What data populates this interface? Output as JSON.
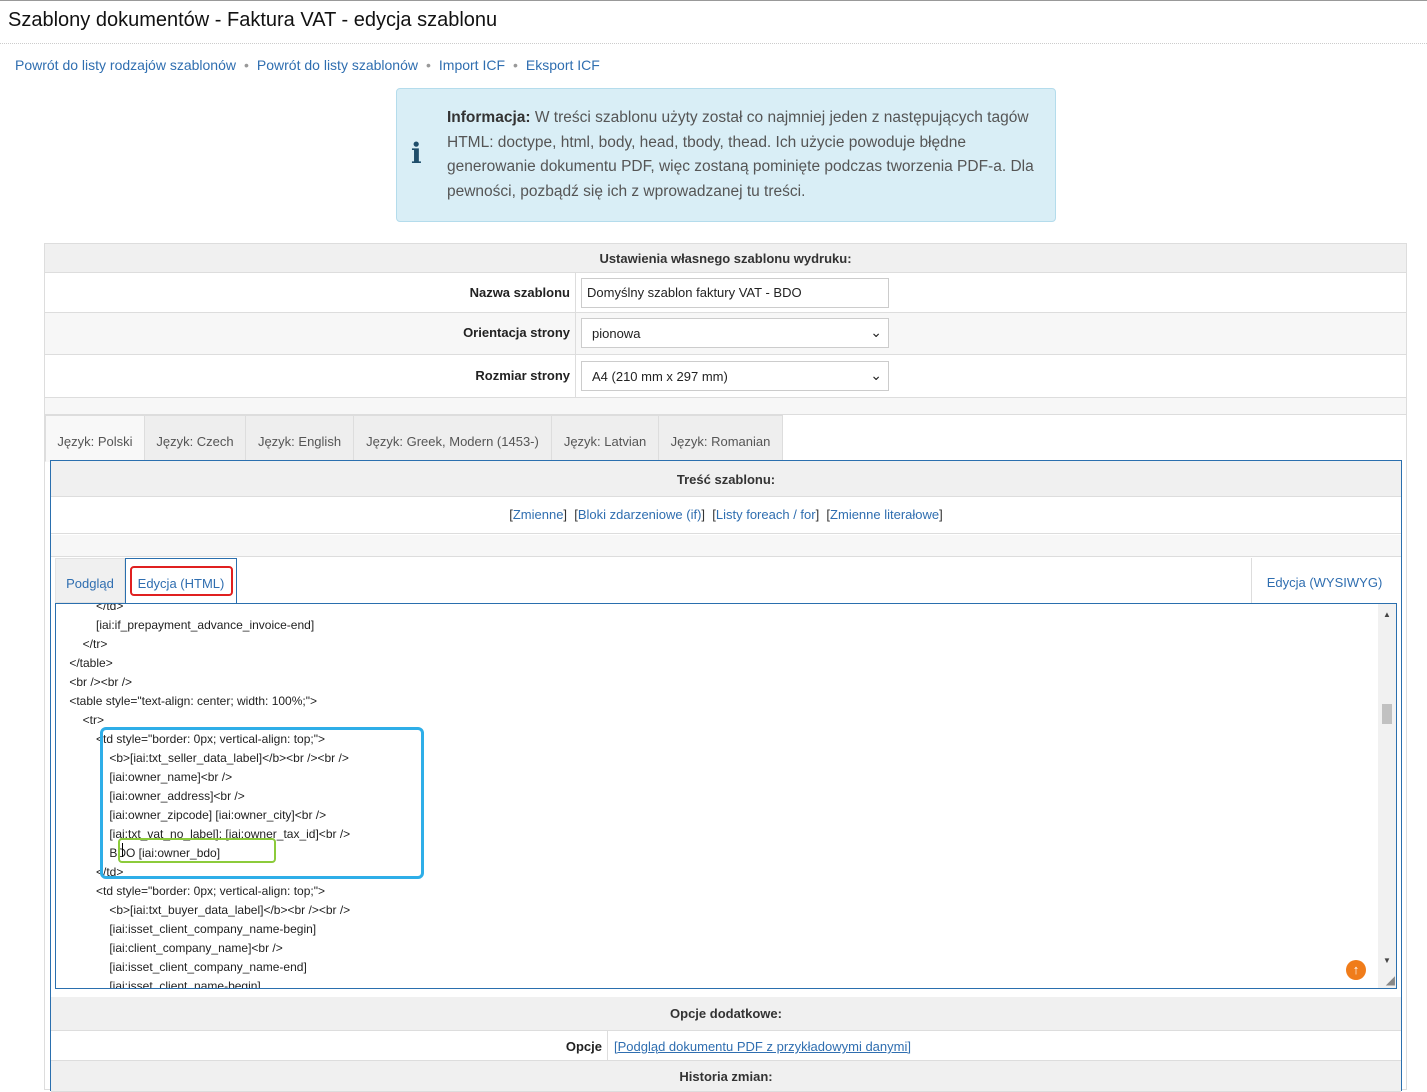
{
  "page": {
    "title": "Szablony dokumentów - Faktura VAT - edycja szablonu"
  },
  "breadcrumb": [
    "Powrót do listy rodzajów szablonów",
    "Powrót do listy szablonów",
    "Import ICF",
    "Eksport ICF"
  ],
  "info": {
    "label": "Informacja:",
    "text": "W treści szablonu użyty został co najmniej jeden z następujących tagów HTML: doctype, html, body, head, tbody, thead. Ich użycie powoduje błędne generowanie dokumentu PDF, więc zostaną pominięte podczas tworzenia PDF-a. Dla pewności, pozbądź się ich z wprowadzanej tu treści.",
    "icon": "info-icon"
  },
  "settings": {
    "header": "Ustawienia własnego szablonu wydruku:",
    "name_label": "Nazwa szablonu",
    "name_value": "Domyślny szablon faktury VAT - BDO",
    "orientation_label": "Orientacja strony",
    "orientation_value": "pionowa",
    "size_label": "Rozmiar strony",
    "size_value": "A4 (210 mm x 297 mm)"
  },
  "language_tabs": [
    "Język: Polski",
    "Język: Czech",
    "Język: English",
    "Język: Greek, Modern (1453-)",
    "Język: Latvian",
    "Język: Romanian"
  ],
  "content": {
    "header": "Treść szablonu:",
    "links": [
      "Zmienne",
      "Bloki zdarzeniowe (if)",
      "Listy foreach / for",
      "Zmienne literałowe"
    ]
  },
  "editor_tabs": {
    "preview": "Podgląd",
    "html": "Edycja (HTML)",
    "wysiwyg": "Edycja (WYSIWYG)"
  },
  "code_lines": [
    "            </td>",
    "            [iai:if_prepayment_advance_invoice-end]",
    "        </tr>",
    "    </table>",
    "    <br /><br />",
    "    <table style=\"text-align: center; width: 100%;\">",
    "        <tr>",
    "            <td style=\"border: 0px; vertical-align: top;\">",
    "                <b>[iai:txt_seller_data_label]</b><br /><br />",
    "                [iai:owner_name]<br />",
    "                [iai:owner_address]<br />",
    "                [iai:owner_zipcode] [iai:owner_city]<br />",
    "                [iai:txt_vat_no_label]: [iai:owner_tax_id]<br />",
    "                BDO [iai:owner_bdo]",
    "            </td>",
    "            <td style=\"border: 0px; vertical-align: top;\">",
    "                <b>[iai:txt_buyer_data_label]</b><br /><br />",
    "                [iai:isset_client_company_name-begin]",
    "                [iai:client_company_name]<br />",
    "                [iai:isset_client_company_name-end]",
    "                [iai:isset_client_name-begin]"
  ],
  "options": {
    "header": "Opcje dodatkowe:",
    "label": "Opcje",
    "link": "[Podgląd dokumentu PDF z przykładowymi danymi]"
  },
  "history": {
    "header": "Historia zmian:"
  },
  "colors": {
    "link": "#2f6eb0",
    "info_bg": "#d9eef6",
    "highlight_blue": "#2eaee8",
    "highlight_green": "#8ccb3b",
    "highlight_red": "#e02020",
    "scroll_top_button": "#f07c1a"
  }
}
